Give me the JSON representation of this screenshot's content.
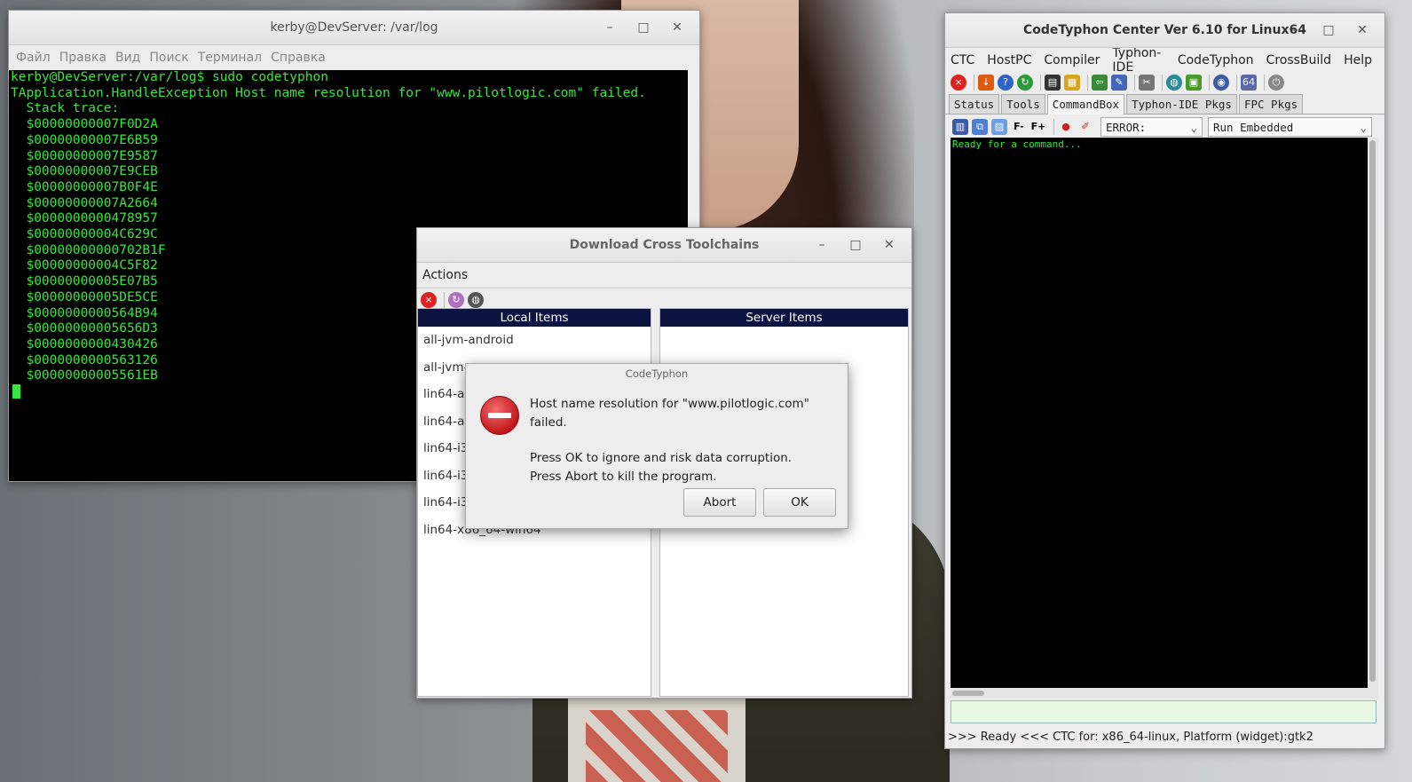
{
  "terminal": {
    "title": "kerby@DevServer: /var/log",
    "menu": [
      "Файл",
      "Правка",
      "Вид",
      "Поиск",
      "Терминал",
      "Справка"
    ],
    "lines": [
      "kerby@DevServer:/var/log$ sudo codetyphon",
      "TApplication.HandleException Host name resolution for \"www.pilotlogic.com\" failed.",
      "  Stack trace:",
      "  $00000000007F0D2A",
      "  $00000000007E6B59",
      "  $00000000007E9587",
      "  $00000000007E9CEB",
      "  $00000000007B0F4E",
      "  $00000000007A2664",
      "  $0000000000478957",
      "  $00000000004C629C",
      "  $00000000000702B1F",
      "  $00000000004C5F82",
      "  $00000000005E07B5",
      "  $00000000005DE5CE",
      "  $0000000000564B94",
      "  $00000000005656D3",
      "  $0000000000430426",
      "  $0000000000563126",
      "  $00000000005561EB"
    ]
  },
  "ctc": {
    "title": "CodeTyphon Center Ver 6.10 for Linux64",
    "menu": [
      "CTC",
      "HostPC",
      "Compiler",
      "Typhon-IDE",
      "CodeTyphon",
      "CrossBuild",
      "Help"
    ],
    "tabs": [
      "Status",
      "Tools",
      "CommandBox",
      "Typhon-IDE Pkgs",
      "FPC Pkgs"
    ],
    "active_tab": "CommandBox",
    "log_level": "ERROR:",
    "run_mode": "Run Embedded",
    "output_text": "Ready for a command...",
    "status_text": ">>> Ready <<<  CTC for: x86_64-linux, Platform (widget):gtk2",
    "toolbar_icons": [
      "close-icon",
      "download-icon",
      "help-icon",
      "refresh-icon",
      "terminal-icon",
      "folder-icon",
      "import-icon",
      "build-icon",
      "tools-icon",
      "globe-download-icon",
      "package-install-icon",
      "world-icon",
      "64bit-icon",
      "power-icon"
    ],
    "cmd_icons": [
      "clear-icon",
      "copy-icon",
      "paste-icon",
      "font-decrease-icon",
      "font-increase-icon",
      "red-dots-icon",
      "eraser-icon"
    ]
  },
  "download": {
    "title": "Download Cross Toolchains",
    "menu": [
      "Actions"
    ],
    "local_header": "Local Items",
    "server_header": "Server Items",
    "local_items": [
      "all-jvm-android",
      "all-jvm-",
      "lin64-ar",
      "lin64-ar",
      "lin64-i3",
      "lin64-i3",
      "lin64-i3",
      "lin64-x86_64-win64"
    ]
  },
  "dialog": {
    "title": "CodeTyphon",
    "message_line1": "Host name resolution for \"www.pilotlogic.com\" failed.",
    "message_line2": "Press OK to ignore and risk data corruption.",
    "message_line3": "Press Abort to kill the program.",
    "abort_label": "Abort",
    "ok_label": "OK"
  },
  "window_controls": {
    "minimize": "–",
    "maximize": "□",
    "close": "✕"
  }
}
